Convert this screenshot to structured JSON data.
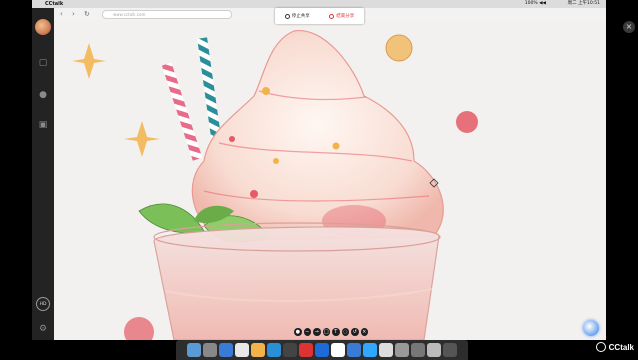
{
  "menubar": {
    "apple": "",
    "app_name": "CCtalk",
    "status": "100% ◀◀ ",
    "clock": "周二 上午10:51"
  },
  "browser": {
    "back": "‹",
    "forward": "›",
    "refresh": "↻",
    "url": "www.cctalk.com"
  },
  "share_control": {
    "pause_label": "停止共享",
    "stop_label": "结束分享"
  },
  "sidebar": {
    "hd_label": "HD"
  },
  "cctalk_logo": "CCtalk",
  "colors": {
    "canvas": "#f3f1ef",
    "cream": "#f8e7df",
    "pink": "#e86b72",
    "teal": "#2b8f99",
    "leaf": "#7bbf58",
    "gold": "#f2b34a"
  }
}
